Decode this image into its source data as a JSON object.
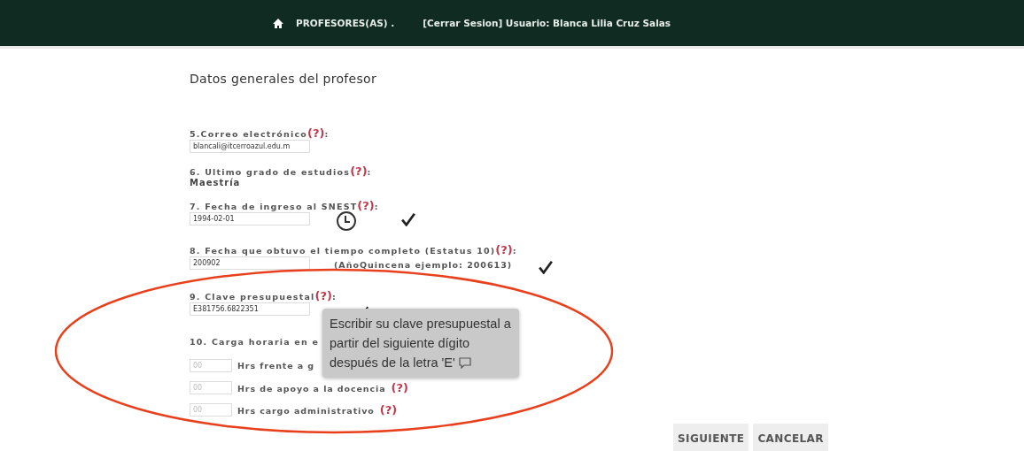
{
  "header": {
    "items": [
      "PROFESORES(AS) .",
      "[Cerrar Sesion] Usuario: Blanca Lilia Cruz Salas"
    ]
  },
  "title": "Datos generales del profesor",
  "fields": [
    {
      "label": "5.Correo electrónico",
      "help": "(?)",
      "suffix": ":",
      "kind": "input",
      "value": "blancali@itcerroazul.edu.m"
    },
    {
      "label": "6. Ultimo grado de estudios",
      "help": "(?)",
      "suffix": ":",
      "kind": "text",
      "value": "Maestría"
    },
    {
      "label": "7. Fecha de ingreso al SNEST",
      "help": "(?)",
      "suffix": ":",
      "kind": "date",
      "value": "1994-02-01",
      "valid": true
    },
    {
      "label": "8. Fecha que obtuvo el tiempo completo (Estatus 10)",
      "help": "(?)",
      "suffix": " :",
      "kind": "input",
      "value": "200902",
      "hint": "(AñoQuincena ejemplo: 200613)",
      "valid": true
    },
    {
      "label": "9. Clave presupuestal",
      "help": "(?)",
      "suffix": ":",
      "kind": "input",
      "value": "E381756.6822351",
      "valid": true
    }
  ],
  "workload": {
    "label": "10. Carga horaria en e",
    "hours": [
      {
        "placeholder": "00",
        "label": "Hrs frente a g"
      },
      {
        "placeholder": "00",
        "label": "Hrs de apoyo a la docencia",
        "help": "(?)"
      },
      {
        "placeholder": "00",
        "label": "Hrs cargo administrativo",
        "help": "(?)"
      }
    ]
  },
  "tooltip": "Escribir su clave presupuestal a partir del siguiente dígito después de la letra 'E'",
  "buttons": [
    "SIGUIENTE",
    "CANCELAR"
  ]
}
